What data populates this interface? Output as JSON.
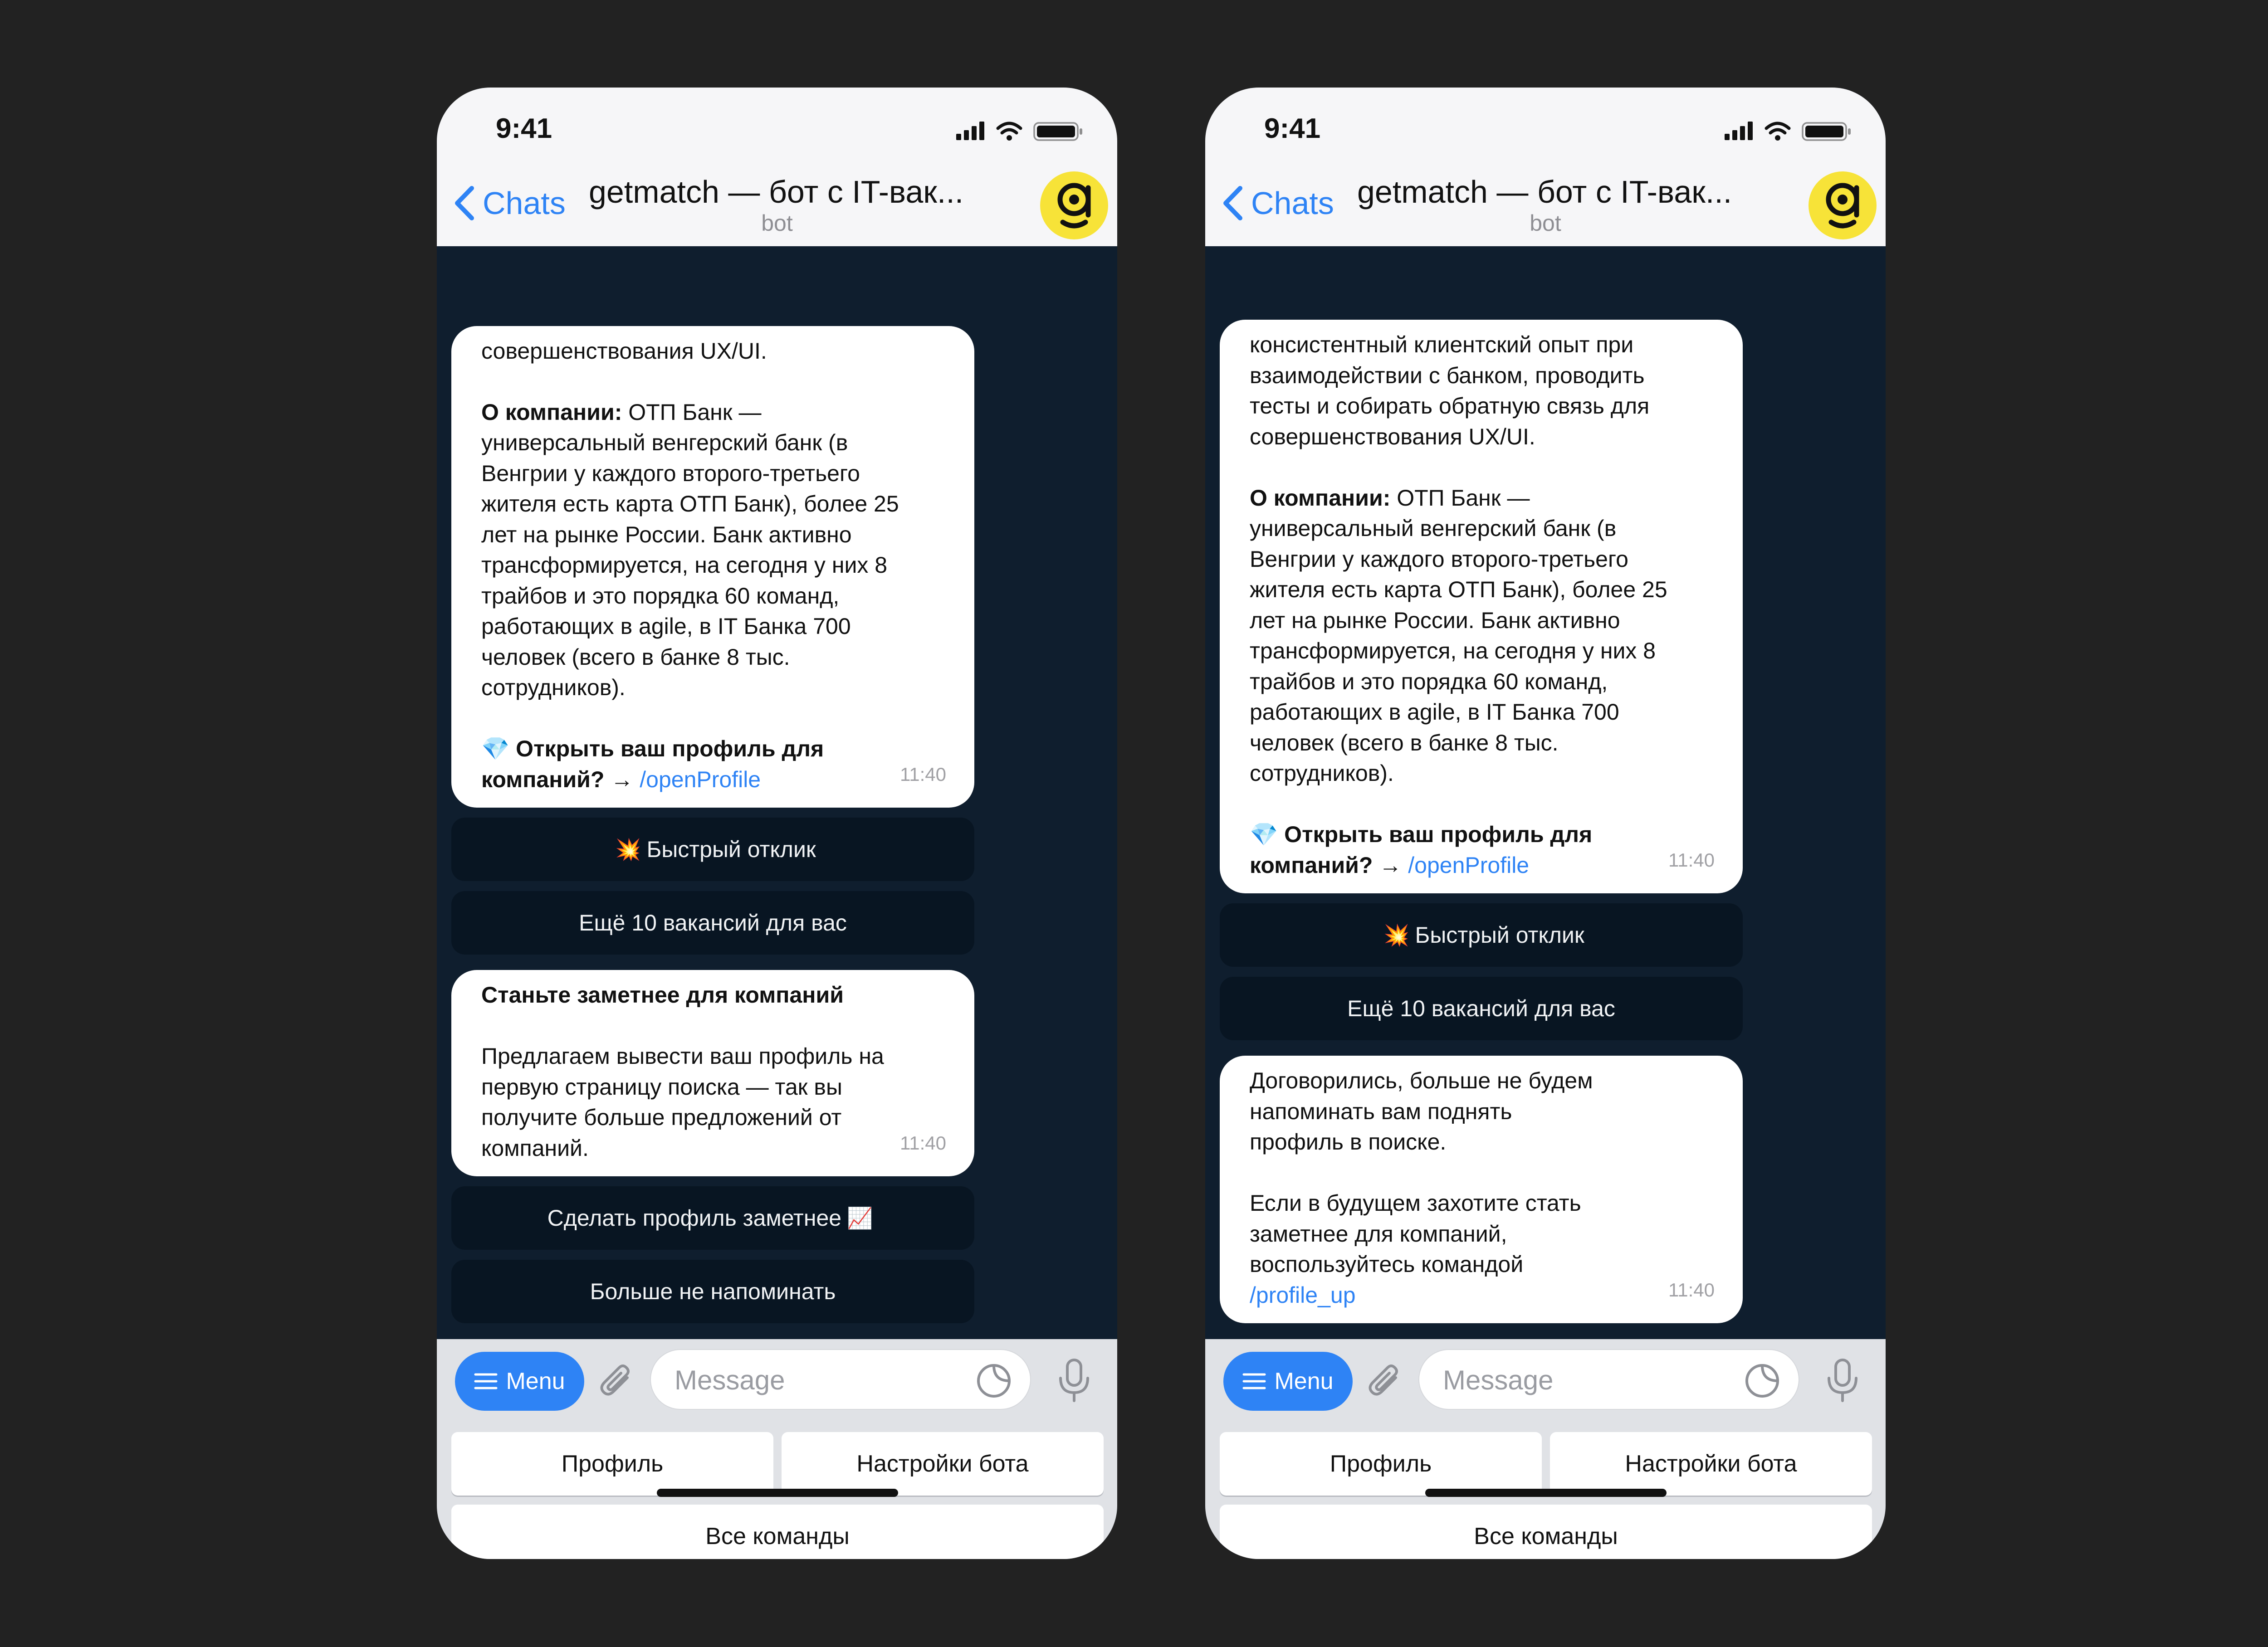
{
  "colors": {
    "accent": "#2e83f5",
    "chat_bg": "#0f1e2e",
    "avatar_bg": "#f7e338",
    "canvas_bg": "#222222"
  },
  "phones": [
    {
      "status": {
        "time": "9:41"
      },
      "header": {
        "back_label": "Chats",
        "title": "getmatch — бот с IT-вак...",
        "subtitle": "bot"
      },
      "messages": [
        {
          "lines": [
            "совершенствования UX/UI."
          ],
          "company_label": "О компании:",
          "company_first": " ОТП Банк —",
          "company_lines": [
            "универсальный венгерский банк (в",
            "Венгрии у каждого второго-третьего",
            "жителя есть карта ОТП Банк), более 25",
            "лет на рынке России. Банк активно",
            "трансформируется, на сегодня у них 8",
            "трайбов и это порядка 60 команд,",
            "работающих в agile, в IT Банка 700",
            "человек (всего в банке 8 тыс.",
            "сотрудников)."
          ],
          "profile_line1": "Открыть ваш профиль для",
          "profile_line2": "компаний? →",
          "profile_link": "/openProfile",
          "time": "11:40"
        },
        {
          "title": "Станьте заметнее для компаний",
          "lines": [
            "Предлагаем вывести ваш профиль на",
            "первую страницу поиска — так вы",
            "получите больше предложений от",
            "компаний."
          ],
          "time": "11:40"
        }
      ],
      "buttons": {
        "quick_reply": "Быстрый отклик",
        "more_vacancies": "Ещё 10 вакансий для вас",
        "make_visible": "Сделать профиль заметнее",
        "no_remind": "Больше не напоминать"
      },
      "input": {
        "menu_label": "Menu",
        "placeholder": "Message"
      },
      "keyboard": {
        "profile": "Профиль",
        "settings": "Настройки бота",
        "all_commands": "Все команды"
      }
    },
    {
      "status": {
        "time": "9:41"
      },
      "header": {
        "back_label": "Chats",
        "title": "getmatch — бот с IT-вак...",
        "subtitle": "bot"
      },
      "messages": [
        {
          "lines": [
            "консистентный клиентский опыт при",
            "взаимодействии с банком, проводить",
            "тесты и собирать обратную связь для",
            "совершенствования UX/UI."
          ],
          "company_label": "О компании:",
          "company_first": " ОТП Банк —",
          "company_lines": [
            "универсальный венгерский банк (в",
            "Венгрии у каждого второго-третьего",
            "жителя есть карта ОТП Банк), более 25",
            "лет на рынке России. Банк активно",
            "трансформируется, на сегодня у них 8",
            "трайбов и это порядка 60 команд,",
            "работающих в agile, в IT Банка 700",
            "человек (всего в банке 8 тыс.",
            "сотрудников)."
          ],
          "profile_line1": "Открыть ваш профиль для",
          "profile_line2": "компаний? →",
          "profile_link": "/openProfile",
          "time": "11:40"
        },
        {
          "lines_a": [
            "Договорились, больше не будем",
            "напоминать вам поднять",
            "профиль в поиске."
          ],
          "lines_b": [
            "Если в будущем захотите стать",
            "заметнее для компаний,",
            "воспользуйтесь командой"
          ],
          "link": "/profile_up",
          "time": "11:40"
        }
      ],
      "buttons": {
        "quick_reply": "Быстрый отклик",
        "more_vacancies": "Ещё 10 вакансий для вас"
      },
      "input": {
        "menu_label": "Menu",
        "placeholder": "Message"
      },
      "keyboard": {
        "profile": "Профиль",
        "settings": "Настройки бота",
        "all_commands": "Все команды"
      }
    }
  ]
}
